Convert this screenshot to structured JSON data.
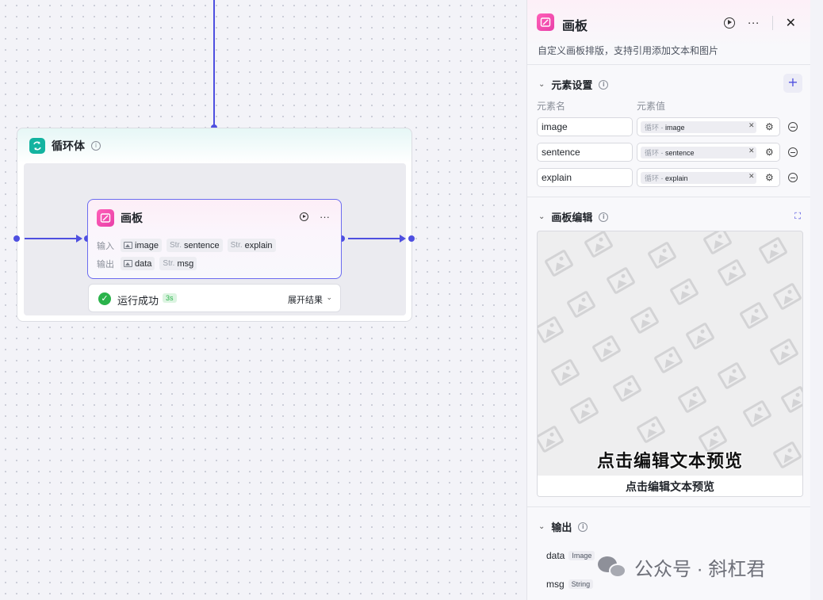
{
  "loop": {
    "title": "循环体"
  },
  "node": {
    "title": "画板",
    "input_label": "输入",
    "output_label": "输出",
    "inputs": [
      {
        "prefix": "",
        "name": "image",
        "icon": "image-icon"
      },
      {
        "prefix": "Str.",
        "name": "sentence"
      },
      {
        "prefix": "Str.",
        "name": "explain"
      }
    ],
    "outputs": [
      {
        "prefix": "",
        "name": "data",
        "icon": "image-icon"
      },
      {
        "prefix": "Str.",
        "name": "msg"
      }
    ]
  },
  "status": {
    "text": "运行成功",
    "time": "3s",
    "expand": "展开结果"
  },
  "panel": {
    "title": "画板",
    "description": "自定义画板排版，支持引用添加文本和图片",
    "elements_section": "元素设置",
    "col_name": "元素名",
    "col_value": "元素值",
    "elements": [
      {
        "name": "image",
        "ref_prefix": "循环 -",
        "ref": "image"
      },
      {
        "name": "sentence",
        "ref_prefix": "循环 -",
        "ref": "sentence"
      },
      {
        "name": "explain",
        "ref_prefix": "循环 -",
        "ref": "explain"
      }
    ],
    "canvas_section": "画板编辑",
    "preview_text": "点击编辑文本预览",
    "preview_caption": "点击编辑文本预览",
    "output_section": "输出",
    "outputs": [
      {
        "name": "data",
        "type": "Image"
      },
      {
        "name": "msg",
        "type": "String"
      }
    ]
  },
  "watermark": {
    "text": "公众号 · 斜杠君"
  },
  "colors": {
    "accent": "#4e4fe0",
    "success": "#2bb34b",
    "loop": "#13b3a0",
    "board": "#e83fa8"
  }
}
